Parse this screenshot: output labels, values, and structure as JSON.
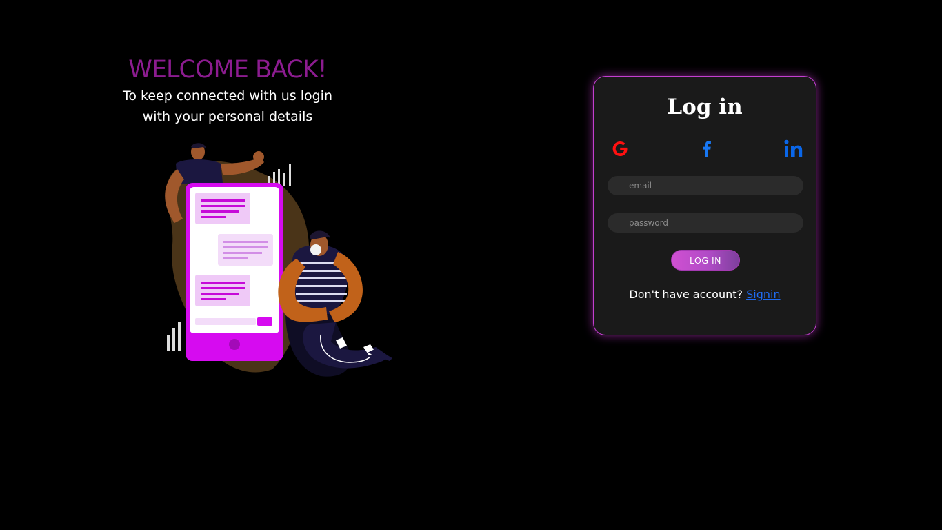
{
  "welcome": {
    "title": "WELCOME BACK!",
    "subtitle": "To keep connected with us login with your personal details",
    "title_color": "#8c1c90"
  },
  "login": {
    "title": "Log in",
    "social": [
      {
        "icon": "google-icon",
        "color": "#ff1010"
      },
      {
        "icon": "facebook-icon",
        "color": "#1877f2"
      },
      {
        "icon": "linkedin-icon",
        "color": "#0a66e8"
      }
    ],
    "email_placeholder": "email",
    "password_placeholder": "password",
    "button_label": "LOG IN",
    "no_account_text": "Don't have account? ",
    "signup_link_label": "Signin",
    "accent": "#c33fd0",
    "card_bg": "#1a1a1a"
  }
}
